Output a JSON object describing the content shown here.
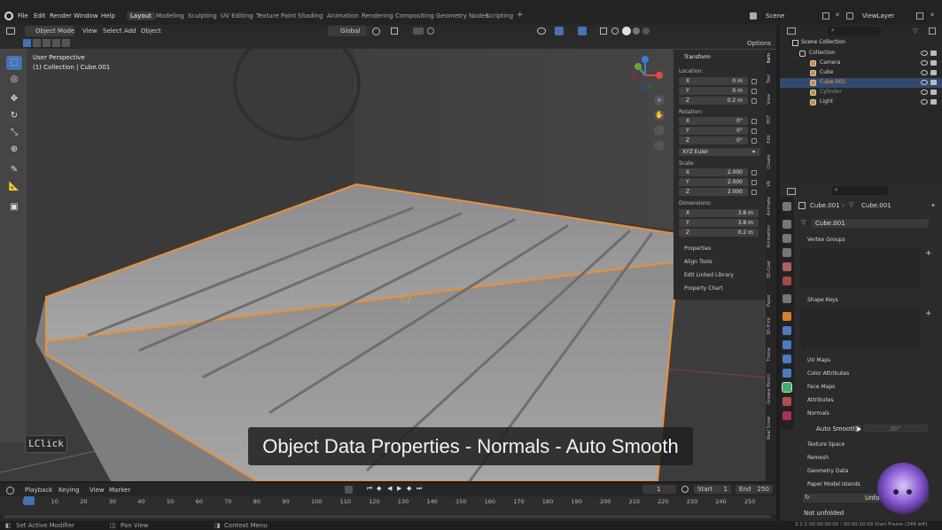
{
  "topbar": {
    "menus": [
      "File",
      "Edit",
      "Render",
      "Window",
      "Help"
    ],
    "workspaces": [
      "Layout",
      "Modeling",
      "Sculpting",
      "UV Editing",
      "Texture Paint",
      "Shading",
      "Animation",
      "Rendering",
      "Compositing",
      "Geometry Nodes",
      "Scripting"
    ],
    "active_workspace": "Layout",
    "add_tab": "+",
    "scene": "Scene",
    "view_layer": "ViewLayer"
  },
  "viewport_header": {
    "mode": "Object Mode",
    "menus": [
      "View",
      "Select",
      "Add",
      "Object"
    ],
    "orientation": "Global",
    "options": "Options"
  },
  "viewport": {
    "perspective": "User Perspective",
    "collection_info": "(1) Collection | Cube.001",
    "gizmo_axes": [
      "X",
      "Y",
      "Z"
    ]
  },
  "npanel": {
    "transform_title": "Transform",
    "location_label": "Location:",
    "location": [
      {
        "ax": "X",
        "val": "0 m"
      },
      {
        "ax": "Y",
        "val": "0 m"
      },
      {
        "ax": "Z",
        "val": "0.2 m"
      }
    ],
    "rotation_label": "Rotation:",
    "rotation": [
      {
        "ax": "X",
        "val": "0°"
      },
      {
        "ax": "Y",
        "val": "0°"
      },
      {
        "ax": "Z",
        "val": "0°"
      }
    ],
    "rotation_mode": "XYZ Euler",
    "scale_label": "Scale:",
    "scale": [
      {
        "ax": "X",
        "val": "2.000"
      },
      {
        "ax": "Y",
        "val": "2.000"
      },
      {
        "ax": "Z",
        "val": "2.000"
      }
    ],
    "dimensions_label": "Dimensions:",
    "dimensions": [
      {
        "ax": "X",
        "val": "3.8 m"
      },
      {
        "ax": "Y",
        "val": "3.8 m"
      },
      {
        "ax": "Z",
        "val": "0.2 m"
      }
    ],
    "sections": [
      "Properties",
      "Align Tools",
      "Edit Linked Library",
      "Property Chart"
    ],
    "side_tabs": [
      "Item",
      "Tool",
      "View",
      "PDT",
      "Edit",
      "Create",
      "VR",
      "Animate",
      "Animation",
      "3D-Coat",
      "Paper",
      "3D-Print",
      "Tissue",
      "Grease Pencil",
      "Real Snow"
    ]
  },
  "outliner": {
    "title": "Scene Collection",
    "rows": [
      {
        "label": "Collection",
        "color": "#cfcfcf",
        "selected": false,
        "indent": 0
      },
      {
        "label": "Camera",
        "color": "#cfcfcf",
        "selected": false,
        "indent": 1
      },
      {
        "label": "Cube",
        "color": "#cfcfcf",
        "selected": false,
        "indent": 1
      },
      {
        "label": "Cube.001",
        "color": "#f0a040",
        "selected": true,
        "indent": 1
      },
      {
        "label": "Cylinder",
        "color": "#8a8a8a",
        "selected": false,
        "indent": 1
      },
      {
        "label": "Light",
        "color": "#cfcfcf",
        "selected": false,
        "indent": 1
      }
    ]
  },
  "properties": {
    "breadcrumb_object": "Cube.001",
    "breadcrumb_data": "Cube.001",
    "mesh_name": "Cube.001",
    "vertex_groups": "Vertex Groups",
    "shape_keys": "Shape Keys",
    "sections": [
      "UV Maps",
      "Color Attributes",
      "Face Maps",
      "Attributes",
      "Normals"
    ],
    "auto_smooth_label": "Auto Smooth",
    "auto_smooth_value": "30°",
    "sections_after": [
      "Texture Space",
      "Remesh",
      "Geometry Data",
      "Paper Model Islands"
    ],
    "unfold_button": "Unfold",
    "not_unfolded": "Not unfolded"
  },
  "timeline": {
    "menus": [
      "Playback",
      "Keying",
      "View",
      "Marker"
    ],
    "current_frame": "1",
    "start_label": "Start",
    "start": "1",
    "end_label": "End",
    "end": "250",
    "ruler": [
      "1",
      "10",
      "20",
      "30",
      "40",
      "50",
      "60",
      "70",
      "80",
      "90",
      "100",
      "110",
      "120",
      "130",
      "140",
      "150",
      "160",
      "170",
      "180",
      "190",
      "200",
      "210",
      "220",
      "230",
      "240",
      "250"
    ]
  },
  "statusbar": {
    "left": "Set Active Modifier",
    "middle": "Pan View",
    "right": "Context Menu",
    "info": "3.2.2  00:00:00:00 / 00:00:10:09  Start Frame (249 left)"
  },
  "overlay": {
    "caption": "Object Data Properties - Normals - Auto Smooth",
    "key_hint": "LClick"
  },
  "colors": {
    "accent": "#4772b3",
    "selection_outline": "#e8913a",
    "active_object": "#f0a040"
  }
}
